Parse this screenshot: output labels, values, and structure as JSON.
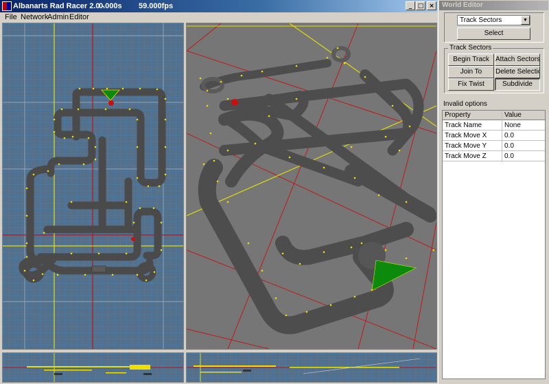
{
  "window": {
    "title": "Albanarts Rad Racer 2.0 -",
    "time": "0.000s",
    "fps": "59.000fps",
    "buttons": [
      "_",
      "□",
      "×"
    ]
  },
  "menu": [
    "File",
    "Network",
    "Admin",
    "Editor"
  ],
  "editor": {
    "title": "World Editor",
    "dropdown_value": "Track Sectors",
    "select_label": "Select",
    "group_label": "Track Sectors",
    "buttons": {
      "begin_track": "Begin Track",
      "attach_sectors": "Attach Sectors",
      "join_to": "Join To",
      "delete_selection": "Delete Selection",
      "fix_twist": "Fix Twist",
      "subdivide": "Subdivide"
    },
    "props_title": "Invalid options",
    "props_headers": [
      "Property",
      "Value"
    ],
    "props_rows": [
      {
        "property": "Track Name",
        "value": "None"
      },
      {
        "property": "Track Move X",
        "value": "0.0"
      },
      {
        "property": "Track Move Y",
        "value": "0.0"
      },
      {
        "property": "Track Move Z",
        "value": "0.0"
      }
    ]
  },
  "colors": {
    "grid_line": "#3a80b8",
    "axis_red": "#c81010",
    "axis_yellow": "#e8e000",
    "track": "#555555",
    "sector_dot": "#f0e000",
    "selection": "#0c8a0c"
  },
  "icons": [
    "app-icon",
    "minimize-icon",
    "maximize-icon",
    "close-icon",
    "dropdown-arrow-icon"
  ]
}
